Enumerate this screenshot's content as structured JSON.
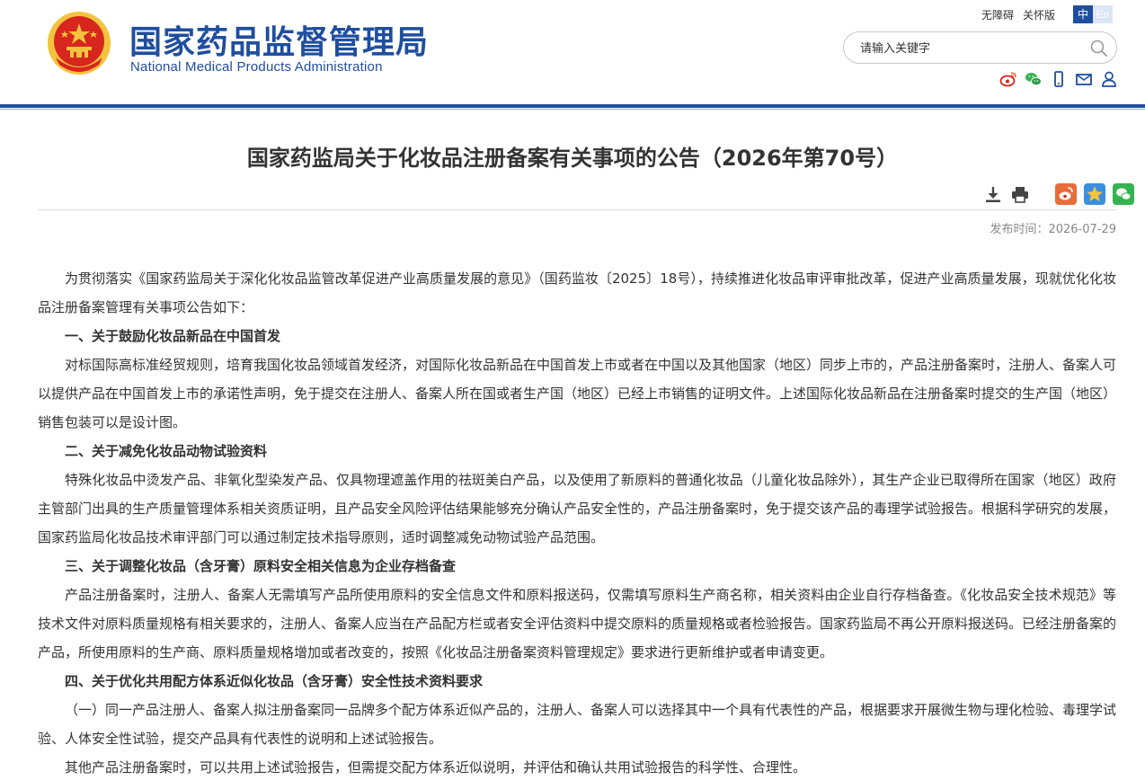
{
  "header": {
    "title_cn": "国家药品监督管理局",
    "title_en": "National Medical Products Administration",
    "links": [
      "无障碍",
      "关怀版"
    ],
    "lang_zh": "中",
    "lang_en": "En",
    "search_placeholder": "请输入关键字"
  },
  "colors": {
    "brand_blue": "#1f4e9e",
    "emblem_red": "#d7261e",
    "emblem_gold": "#f4c33d",
    "social_orange": "#e96d3a",
    "social_green": "#34b350"
  },
  "article": {
    "title": "国家药监局关于化妆品注册备案有关事项的公告（2026年第70号）",
    "pubtime": "发布时间：2026-07-29",
    "paragraphs": [
      {
        "type": "text",
        "text": "为贯彻落实《国家药监局关于深化化妆品监管改革促进产业高质量发展的意见》（国药监妆〔2025〕18号），持续推进化妆品审评审批改革，促进产业高质量发展，现就优化化妆品注册备案管理有关事项公告如下："
      },
      {
        "type": "heading",
        "text": "一、关于鼓励化妆品新品在中国首发"
      },
      {
        "type": "text",
        "text": "对标国际高标准经贸规则，培育我国化妆品领域首发经济，对国际化妆品新品在中国首发上市或者在中国以及其他国家（地区）同步上市的，产品注册备案时，注册人、备案人可以提供产品在中国首发上市的承诺性声明，免于提交在注册人、备案人所在国或者生产国（地区）已经上市销售的证明文件。上述国际化妆品新品在注册备案时提交的生产国（地区）销售包装可以是设计图。"
      },
      {
        "type": "heading",
        "text": "二、关于减免化妆品动物试验资料"
      },
      {
        "type": "text",
        "text": "特殊化妆品中烫发产品、非氧化型染发产品、仅具物理遮盖作用的祛斑美白产品，以及使用了新原料的普通化妆品（儿童化妆品除外），其生产企业已取得所在国家（地区）政府主管部门出具的生产质量管理体系相关资质证明，且产品安全风险评估结果能够充分确认产品安全性的，产品注册备案时，免于提交该产品的毒理学试验报告。根据科学研究的发展，国家药监局化妆品技术审评部门可以通过制定技术指导原则，适时调整减免动物试验产品范围。"
      },
      {
        "type": "heading",
        "text": "三、关于调整化妆品（含牙膏）原料安全相关信息为企业存档备查"
      },
      {
        "type": "text",
        "text": "产品注册备案时，注册人、备案人无需填写产品所使用原料的安全信息文件和原料报送码，仅需填写原料生产商名称，相关资料由企业自行存档备查。《化妆品安全技术规范》等技术文件对原料质量规格有相关要求的，注册人、备案人应当在产品配方栏或者安全评估资料中提交原料的质量规格或者检验报告。国家药监局不再公开原料报送码。已经注册备案的产品，所使用原料的生产商、原料质量规格增加或者改变的，按照《化妆品注册备案资料管理规定》要求进行更新维护或者申请变更。"
      },
      {
        "type": "heading",
        "text": "四、关于优化共用配方体系近似化妆品（含牙膏）安全性技术资料要求"
      },
      {
        "type": "text",
        "text": "（一）同一产品注册人、备案人拟注册备案同一品牌多个配方体系近似产品的，注册人、备案人可以选择其中一个具有代表性的产品，根据要求开展微生物与理化检验、毒理学试验、人体安全性试验，提交产品具有代表性的说明和上述试验报告。"
      },
      {
        "type": "text",
        "text": "其他产品注册备案时，可以共用上述试验报告，但需提交配方体系近似说明，并评估和确认共用试验报告的科学性、合理性。"
      }
    ]
  }
}
